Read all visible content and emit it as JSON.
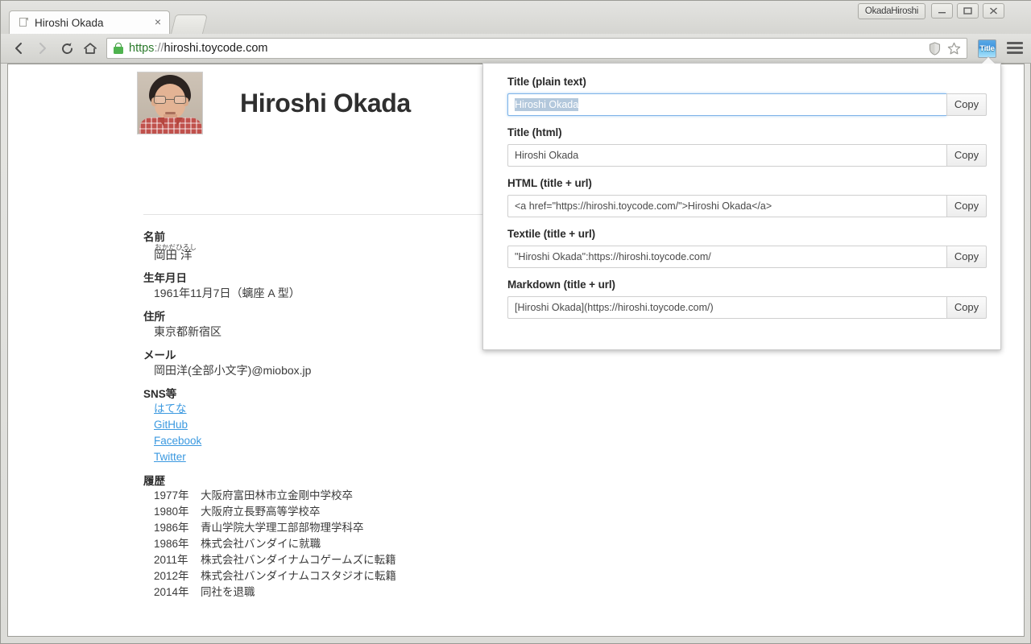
{
  "window": {
    "title": "OkadaHiroshi",
    "controls": {
      "minimize": "minimize",
      "maximize": "maximize",
      "close": "close"
    }
  },
  "tabs": [
    {
      "title": "Hiroshi Okada",
      "close_label": "×"
    }
  ],
  "toolbar": {
    "back": "back",
    "forward": "forward",
    "reload": "reload",
    "home": "home",
    "url_scheme": "https",
    "url_separator": "://",
    "url_host": "hiroshi.toycode.com",
    "url_full": "https://hiroshi.toycode.com",
    "shield_icon": "shield-icon",
    "bookmark_icon": "star-icon",
    "extension_label": "Title",
    "menu_icon": "hamburger-menu-icon"
  },
  "page": {
    "heading": "Hiroshi Okada",
    "photo_alt": "portrait-photo",
    "fields": [
      {
        "label": "名前",
        "type": "ruby",
        "ruby_top": "おかだひろし",
        "ruby_base": "岡田 洋"
      },
      {
        "label": "生年月日",
        "type": "text",
        "value": "1961年11月7日（螭座 A 型）"
      },
      {
        "label": "住所",
        "type": "text",
        "value": "東京都新宿区"
      },
      {
        "label": "メール",
        "type": "text",
        "value": "岡田洋(全部小文字)@miobox.jp"
      },
      {
        "label": "SNS等",
        "type": "links",
        "links": [
          "はてな",
          "GitHub",
          "Facebook",
          "Twitter"
        ]
      },
      {
        "label": "履歴",
        "type": "history",
        "rows": [
          {
            "year": "1977年",
            "text": "大阪府富田林市立金剛中学校卒"
          },
          {
            "year": "1980年",
            "text": "大阪府立長野高等学校卒"
          },
          {
            "year": "1986年",
            "text": "青山学院大学理工部部物理学科卒"
          },
          {
            "year": "1986年",
            "text": "株式会社バンダイに就職"
          },
          {
            "year": "2011年",
            "text": "株式会社バンダイナムコゲームズに転籍"
          },
          {
            "year": "2012年",
            "text": "株式会社バンダイナムコスタジオに転籍"
          },
          {
            "year": "2014年",
            "text": "同社を退職"
          }
        ]
      }
    ]
  },
  "popup": {
    "copy_label": "Copy",
    "fields": [
      {
        "label": "Title (plain text)",
        "value": "Hiroshi Okada",
        "focused": true,
        "selected": true
      },
      {
        "label": "Title (html)",
        "value": "Hiroshi Okada",
        "focused": false,
        "selected": false
      },
      {
        "label": "HTML (title + url)",
        "value": "<a href=\"https://hiroshi.toycode.com/\">Hiroshi Okada</a>",
        "focused": false,
        "selected": false
      },
      {
        "label": "Textile (title + url)",
        "value": "\"Hiroshi Okada\":https://hiroshi.toycode.com/",
        "focused": false,
        "selected": false
      },
      {
        "label": "Markdown (title + url)",
        "value": "[Hiroshi Okada](https://hiroshi.toycode.com/)",
        "focused": false,
        "selected": false
      }
    ]
  },
  "colors": {
    "link": "#3b99e0",
    "selection": "#b3c8dc",
    "focus_border": "#7fb4e8",
    "lock_green": "#4fb34f",
    "extension_blue": "#3f94dd"
  }
}
